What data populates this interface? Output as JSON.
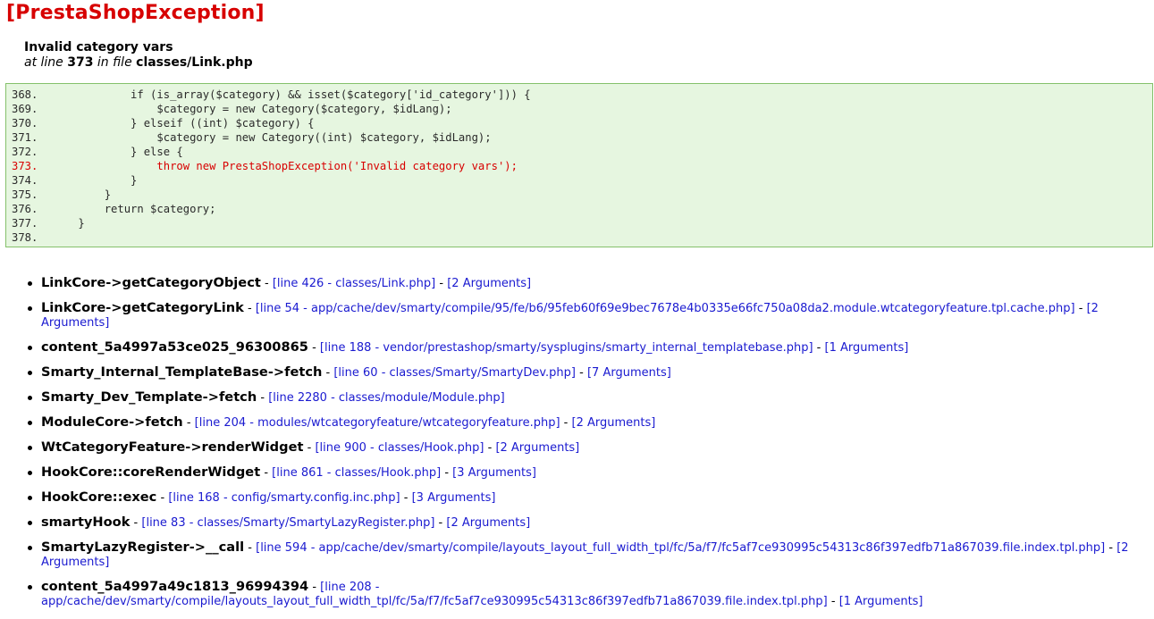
{
  "exception": {
    "title": "[PrestaShopException]",
    "message": "Invalid category vars",
    "at_line_prefix": "at line ",
    "line": "373",
    "in_file_text": " in file ",
    "file": "classes/Link.php"
  },
  "code_lines": [
    {
      "num": "368.",
      "code": "            if (is_array($category) && isset($category['id_category'])) {"
    },
    {
      "num": "369.",
      "code": "                $category = new Category($category, $idLang);"
    },
    {
      "num": "370.",
      "code": "            } elseif ((int) $category) {"
    },
    {
      "num": "371.",
      "code": "                $category = new Category((int) $category, $idLang);"
    },
    {
      "num": "372.",
      "code": "            } else {"
    },
    {
      "num": "373.",
      "code": "                throw new PrestaShopException('Invalid category vars');",
      "error": true
    },
    {
      "num": "374.",
      "code": "            }"
    },
    {
      "num": "375.",
      "code": "        }"
    },
    {
      "num": "376.",
      "code": "        return $category;"
    },
    {
      "num": "377.",
      "code": "    }"
    },
    {
      "num": "378.",
      "code": ""
    }
  ],
  "trace": [
    {
      "fn": "LinkCore->getCategoryObject",
      "loc": "[line 426 - classes/Link.php]",
      "args": "[2 Arguments]"
    },
    {
      "fn": "LinkCore->getCategoryLink",
      "loc": "[line 54 - app/cache/dev/smarty/compile/95/fe/b6/95feb60f69e9bec7678e4b0335e66fc750a08da2.module.wtcategoryfeature.tpl.cache.php]",
      "args": "[2 Arguments]"
    },
    {
      "fn": "content_5a4997a53ce025_96300865",
      "loc": "[line 188 - vendor/prestashop/smarty/sysplugins/smarty_internal_templatebase.php]",
      "args": "[1 Arguments]"
    },
    {
      "fn": "Smarty_Internal_TemplateBase->fetch",
      "loc": "[line 60 - classes/Smarty/SmartyDev.php]",
      "args": "[7 Arguments]"
    },
    {
      "fn": "Smarty_Dev_Template->fetch",
      "loc": "[line 2280 - classes/module/Module.php]",
      "args": ""
    },
    {
      "fn": "ModuleCore->fetch",
      "loc": "[line 204 - modules/wtcategoryfeature/wtcategoryfeature.php]",
      "args": "[2 Arguments]"
    },
    {
      "fn": "WtCategoryFeature->renderWidget",
      "loc": "[line 900 - classes/Hook.php]",
      "args": "[2 Arguments]"
    },
    {
      "fn": "HookCore::coreRenderWidget",
      "loc": "[line 861 - classes/Hook.php]",
      "args": "[3 Arguments]"
    },
    {
      "fn": "HookCore::exec",
      "loc": "[line 168 - config/smarty.config.inc.php]",
      "args": "[3 Arguments]"
    },
    {
      "fn": "smartyHook",
      "loc": "[line 83 - classes/Smarty/SmartyLazyRegister.php]",
      "args": "[2 Arguments]"
    },
    {
      "fn": "SmartyLazyRegister->__call",
      "loc": "[line 594 - app/cache/dev/smarty/compile/layouts_layout_full_width_tpl/fc/5a/f7/fc5af7ce930995c54313c86f397edfb71a867039.file.index.tpl.php]",
      "args": "[2 Arguments]"
    },
    {
      "fn": "content_5a4997a49c1813_96994394",
      "loc": "[line 208 - app/cache/dev/smarty/compile/layouts_layout_full_width_tpl/fc/5a/f7/fc5af7ce930995c54313c86f397edfb71a867039.file.index.tpl.php]",
      "args": "[1 Arguments]"
    }
  ]
}
